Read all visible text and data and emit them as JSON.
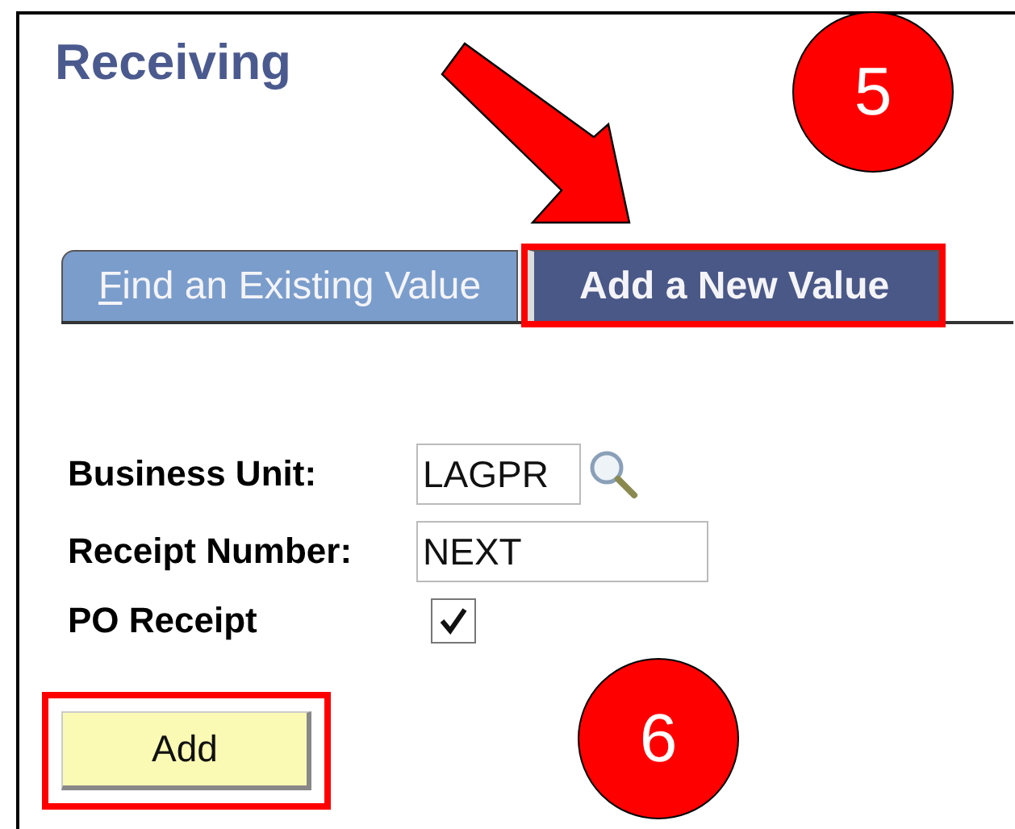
{
  "page": {
    "title": "Receiving"
  },
  "tabs": [
    {
      "label": "Find an Existing Value",
      "selected": false,
      "underline_first": true,
      "highlighted": false
    },
    {
      "label": "Add a New Value",
      "selected": true,
      "underline_first": false,
      "highlighted": true
    }
  ],
  "fields": [
    {
      "kind": "lookup",
      "label": "Business Unit:",
      "value": "LAGPR"
    },
    {
      "kind": "text",
      "label": "Receipt Number:",
      "value": "NEXT"
    },
    {
      "kind": "checkbox",
      "label": "PO Receipt",
      "checked": true
    }
  ],
  "add_button": {
    "label": "Add",
    "highlighted": true
  },
  "callouts": [
    {
      "label": "5"
    },
    {
      "label": "6"
    }
  ]
}
